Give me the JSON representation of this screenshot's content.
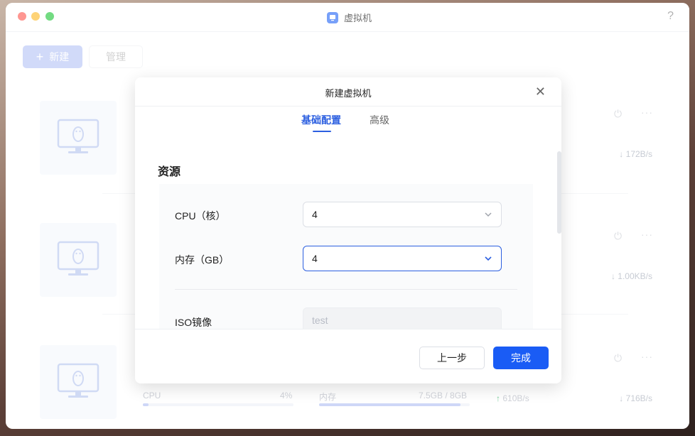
{
  "window": {
    "title": "虚拟机",
    "help": "?"
  },
  "toolbar": {
    "new_label": "新建",
    "manage_label": "管理"
  },
  "vm_cards": [
    {
      "download": "172B/s"
    },
    {
      "download": "1.00KB/s"
    },
    {
      "download": "716B/s",
      "cpu_label": "CPU",
      "cpu_value": "4%",
      "cpu_usage": 0.04,
      "mem_label": "内存",
      "mem_value": "7.5GB / 8GB",
      "mem_usage": 0.94,
      "upload": "610B/s"
    }
  ],
  "modal": {
    "title": "新建虚拟机",
    "tabs": [
      {
        "label": "基础配置",
        "active": true
      },
      {
        "label": "高级",
        "active": false
      }
    ],
    "section_title": "资源",
    "fields": {
      "cpu_label": "CPU（核）",
      "cpu_value": "4",
      "memory_label": "内存（GB）",
      "memory_value": "4",
      "iso_label": "ISO镜像",
      "iso_value": "test"
    },
    "buttons": {
      "prev": "上一步",
      "done": "完成"
    }
  },
  "colors": {
    "accent": "#1a5cf5",
    "tab_active": "#2c5fe0",
    "new_button_disabled": "#b9c7f6",
    "upload_arrow": "#35b56b"
  },
  "icons": [
    "app-icon",
    "help-icon",
    "plus-icon",
    "close-icon",
    "chevron-down-icon",
    "power-icon",
    "more-icon",
    "linux-monitor-icon",
    "arrow-down-icon",
    "arrow-up-icon"
  ]
}
